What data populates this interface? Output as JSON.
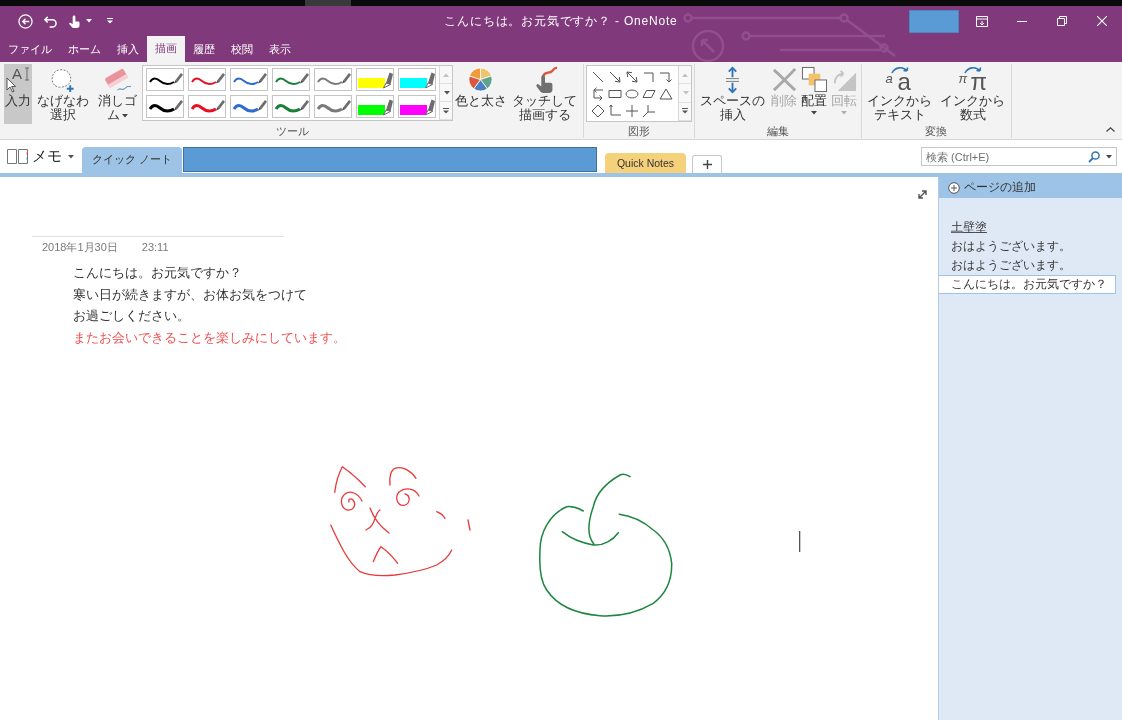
{
  "title_bar": {
    "title": "こんにちは。お元気ですか？ - OneNote"
  },
  "tabs": [
    {
      "label": "ファイル",
      "selected": false
    },
    {
      "label": "ホーム",
      "selected": false
    },
    {
      "label": "挿入",
      "selected": false
    },
    {
      "label": "描画",
      "selected": true
    },
    {
      "label": "履歴",
      "selected": false
    },
    {
      "label": "校閲",
      "selected": false
    },
    {
      "label": "表示",
      "selected": false
    }
  ],
  "ribbon": {
    "groups": [
      {
        "label": "ツール",
        "items": [
          {
            "kind": "button",
            "label": "入力",
            "icon_glyphs": [
              "A"
            ],
            "selected": true
          },
          {
            "kind": "button",
            "label": "なげなわ選択",
            "selected": false
          },
          {
            "kind": "button",
            "label": "消しゴム",
            "selected": false,
            "dropdown": true
          },
          {
            "kind": "pen-gallery",
            "pens": [
              {
                "kind": "thin-pen",
                "color": "#000000",
                "selected": false
              },
              {
                "kind": "thin-pen",
                "color": "#e81123",
                "selected": false
              },
              {
                "kind": "thin-pen",
                "color": "#2e6bd1",
                "selected": false
              },
              {
                "kind": "thin-pen",
                "color": "#1a7f37",
                "selected": false
              },
              {
                "kind": "thin-pen",
                "color": "#7a7a7a",
                "selected": false
              },
              {
                "kind": "highlighter",
                "color": "#ffff00",
                "selected": false
              },
              {
                "kind": "highlighter",
                "color": "#00ffff",
                "selected": false
              },
              {
                "kind": "thick-pen",
                "color": "#000000",
                "selected": false
              },
              {
                "kind": "thick-pen",
                "color": "#e81123",
                "selected": false
              },
              {
                "kind": "thick-pen",
                "color": "#2e6bd1",
                "selected": false
              },
              {
                "kind": "thick-pen",
                "color": "#1a7f37",
                "selected": false
              },
              {
                "kind": "thick-pen",
                "color": "#7a7a7a",
                "selected": false
              },
              {
                "kind": "highlighter",
                "color": "#00ff00",
                "selected": false
              },
              {
                "kind": "highlighter",
                "color": "#ff00ff",
                "selected": false
              }
            ]
          },
          {
            "kind": "button",
            "label": "色と太さ"
          },
          {
            "kind": "button",
            "label": "タッチして描画する"
          }
        ]
      },
      {
        "label": "図形",
        "items": [
          {
            "kind": "shape-gallery"
          }
        ]
      },
      {
        "label": "編集",
        "items": [
          {
            "kind": "button",
            "label": "スペースの挿入",
            "disabled": false
          },
          {
            "kind": "button",
            "label": "削除",
            "disabled": true
          },
          {
            "kind": "button",
            "label": "配置",
            "disabled": false,
            "dropdown": true
          },
          {
            "kind": "button",
            "label": "回転",
            "disabled": true,
            "dropdown": true
          }
        ]
      },
      {
        "label": "変換",
        "items": [
          {
            "kind": "button",
            "label": "インクからテキスト",
            "icon_glyphs": [
              "a",
              "a"
            ]
          },
          {
            "kind": "button",
            "label": "インクから数式",
            "icon_glyphs": [
              "π",
              "π"
            ]
          }
        ]
      }
    ]
  },
  "notebook": {
    "name": "メモ",
    "sections": [
      {
        "kind": "section",
        "label": "クイック ノート",
        "selected": true,
        "color": "#9dc3e6"
      },
      {
        "kind": "redacted"
      },
      {
        "kind": "section",
        "label": "Quick Notes",
        "selected": false,
        "color": "#f5d17b"
      }
    ]
  },
  "search": {
    "placeholder": "検索 (Ctrl+E)"
  },
  "note": {
    "date": "2018年1月30日",
    "time": "23:11",
    "lines": [
      {
        "text": "こんにちは。お元気ですか？",
        "color": "#333333"
      },
      {
        "text": "寒い日が続きますが、お体お気をつけて",
        "color": "#333333"
      },
      {
        "text": "お過ごしください。",
        "color": "#333333"
      },
      {
        "text": "またお会いできることを楽しみにしています。",
        "color": "#f05050"
      }
    ]
  },
  "page_pane": {
    "add_page": "ページの追加",
    "pages": [
      {
        "title": "土壁塗",
        "selected": false,
        "underlined": true
      },
      {
        "title": "おはようございます。",
        "selected": false,
        "underlined": false
      },
      {
        "title": "おはようございます。",
        "selected": false,
        "underlined": false
      },
      {
        "title": "こんにちは。お元気ですか？",
        "selected": true,
        "underlined": false
      }
    ]
  }
}
